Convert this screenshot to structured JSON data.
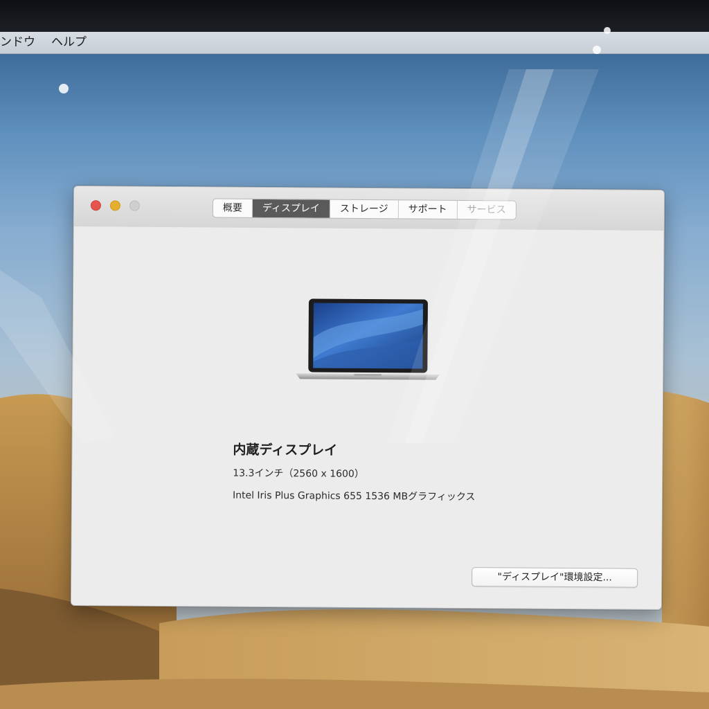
{
  "menubar": {
    "items": [
      "ンドウ",
      "ヘルプ"
    ]
  },
  "window": {
    "tabs": [
      "概要",
      "ディスプレイ",
      "ストレージ",
      "サポート",
      "サービス"
    ],
    "active_tab": "ディスプレイ",
    "display_title": "内蔵ディスプレイ",
    "display_size": "13.3インチ（2560 x 1600）",
    "graphics": "Intel Iris Plus Graphics 655 1536 MBグラフィックス",
    "prefs_button": "\"ディスプレイ\"環境設定..."
  },
  "icons": {
    "close": "close-button",
    "minimize": "minimize-button",
    "zoom": "zoom-button",
    "device": "macbook-pro-icon"
  },
  "colors": {
    "close": "#e5544d",
    "minimize": "#e6ae2f",
    "zoom": "#cfcfcf",
    "active_tab": "#5a5a5a",
    "window_bg": "#ececec"
  }
}
